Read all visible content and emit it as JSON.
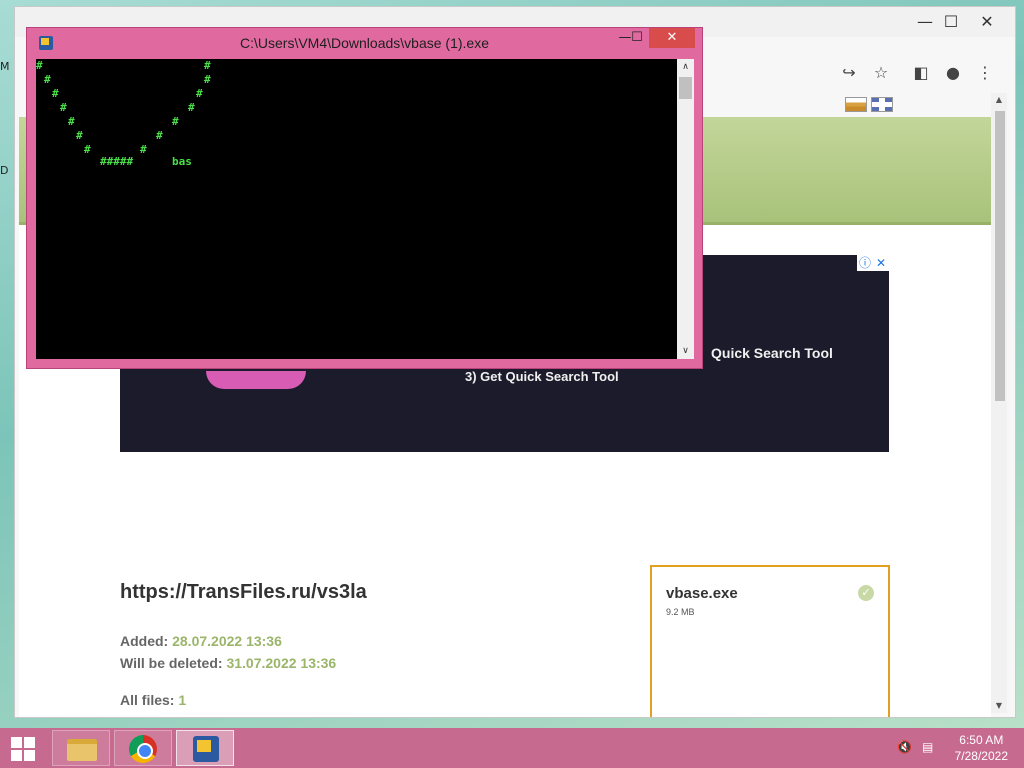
{
  "desktop": {
    "edge_letters": [
      "M",
      "D"
    ]
  },
  "browser": {
    "window_controls": {
      "minimize": "—",
      "maximize": "☐",
      "close": "✕"
    },
    "toolbar": {
      "share_icon": "share-icon",
      "star_icon": "star-icon",
      "sidebar_icon": "side-panel-icon",
      "profile_icon": "profile-icon",
      "menu_icon": "menu-icon"
    },
    "bookmarks": {
      "flags": [
        "ru-flag-icon",
        "uk-flag-icon"
      ]
    }
  },
  "page": {
    "ad": {
      "info_icon": "ⓘ",
      "close_icon": "✕",
      "text_right": "Quick Search Tool",
      "text_step": "3)  Get Quick Search Tool"
    },
    "file_link": "https://TransFiles.ru/vs3la",
    "added_label": "Added:",
    "added_value": "28.07.2022 13:36",
    "deleted_label": "Will be deleted:",
    "deleted_value": "31.07.2022 13:36",
    "all_files_label": "All files:",
    "all_files_value": "1",
    "file_card": {
      "name": "vbase.exe",
      "size": "9.2 MB",
      "check": "✓"
    }
  },
  "console": {
    "title": "C:\\Users\\VM4\\Downloads\\vbase (1).exe",
    "controls": {
      "minimize": "—",
      "maximize": "☐",
      "close": "✕"
    },
    "hash": "#",
    "hash_run": "#####",
    "word": "bas"
  },
  "taskbar": {
    "apps": [
      "file-explorer",
      "chrome",
      "console-app"
    ],
    "active_app": "console-app",
    "time": "6:50 AM",
    "date": "7/28/2022"
  },
  "colors": {
    "console_frame": "#e06aa0",
    "console_text": "#4ae04a",
    "taskbar": "#c76a8f",
    "header_green": "#b5cd8a",
    "accent_value": "#9bb56a",
    "file_card_border": "#e0a020"
  }
}
